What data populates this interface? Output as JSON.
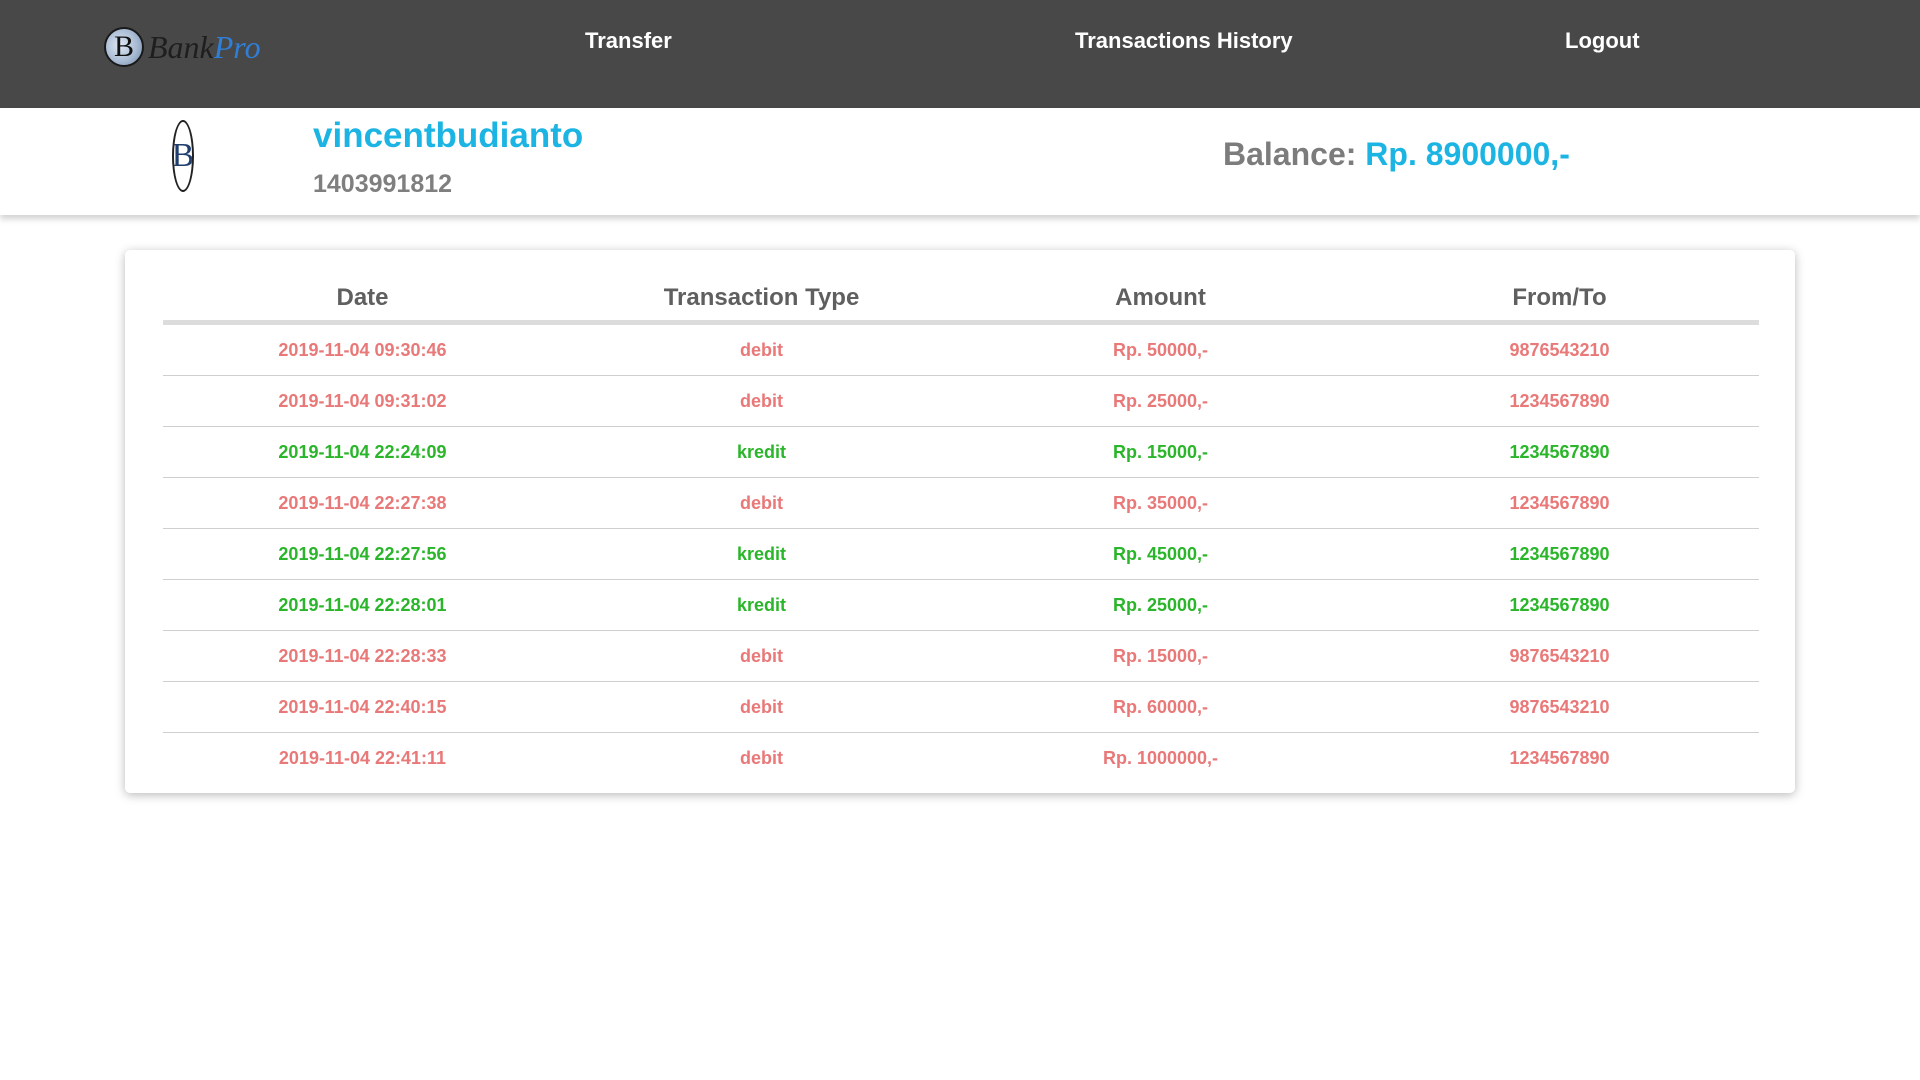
{
  "brand": {
    "logo_letter": "B",
    "word_bank": "Bank",
    "word_pro": "Pro"
  },
  "nav": {
    "transfer": "Transfer",
    "history": "Transactions History",
    "logout": "Logout"
  },
  "profile": {
    "avatar_letter": "B",
    "username": "vincentbudianto",
    "account_number": "1403991812",
    "balance_label": "Balance:",
    "balance_value": "Rp. 8900000,-"
  },
  "table": {
    "columns": [
      "Date",
      "Transaction Type",
      "Amount",
      "From/To"
    ],
    "rows": [
      {
        "date": "2019-11-04 09:30:46",
        "type": "debit",
        "amount": "Rp. 50000,-",
        "account": "9876543210"
      },
      {
        "date": "2019-11-04 09:31:02",
        "type": "debit",
        "amount": "Rp. 25000,-",
        "account": "1234567890"
      },
      {
        "date": "2019-11-04 22:24:09",
        "type": "kredit",
        "amount": "Rp. 15000,-",
        "account": "1234567890"
      },
      {
        "date": "2019-11-04 22:27:38",
        "type": "debit",
        "amount": "Rp. 35000,-",
        "account": "1234567890"
      },
      {
        "date": "2019-11-04 22:27:56",
        "type": "kredit",
        "amount": "Rp. 45000,-",
        "account": "1234567890"
      },
      {
        "date": "2019-11-04 22:28:01",
        "type": "kredit",
        "amount": "Rp. 25000,-",
        "account": "1234567890"
      },
      {
        "date": "2019-11-04 22:28:33",
        "type": "debit",
        "amount": "Rp. 15000,-",
        "account": "9876543210"
      },
      {
        "date": "2019-11-04 22:40:15",
        "type": "debit",
        "amount": "Rp. 60000,-",
        "account": "9876543210"
      },
      {
        "date": "2019-11-04 22:41:11",
        "type": "debit",
        "amount": "Rp. 1000000,-",
        "account": "1234567890"
      }
    ]
  },
  "colors": {
    "navbar_bg": "#484848",
    "accent": "#1cb4e3",
    "debit": "#e97878",
    "kredit": "#2ab52a",
    "muted_text": "#7f7f7f"
  }
}
